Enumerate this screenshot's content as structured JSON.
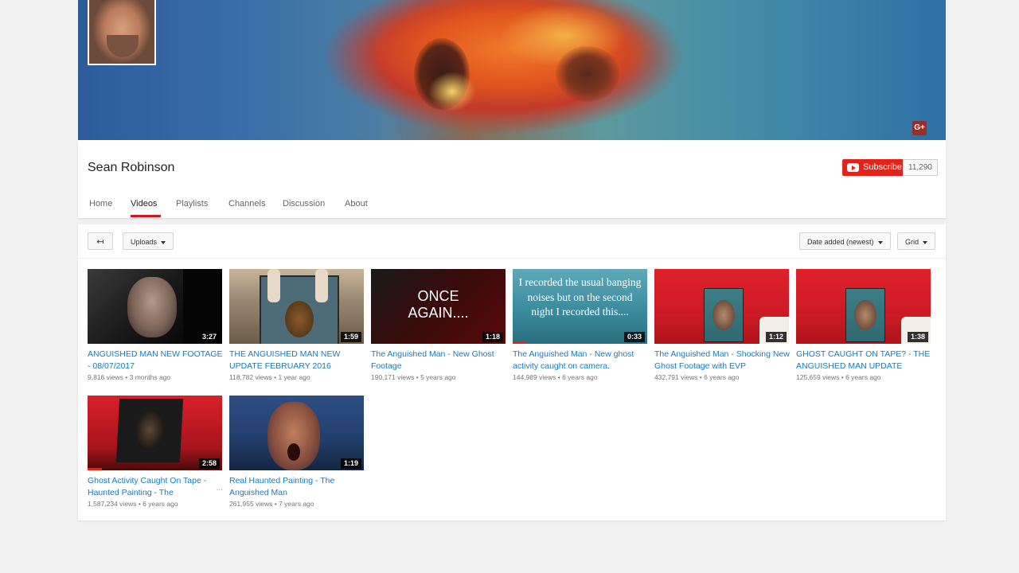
{
  "channel": {
    "name": "Sean Robinson",
    "subscribe_label": "Subscribe",
    "subscriber_count": "11,290",
    "gplus_label": "G+"
  },
  "tabs": [
    "Home",
    "Videos",
    "Playlists",
    "Channels",
    "Discussion",
    "About"
  ],
  "active_tab": "Videos",
  "toolbar": {
    "back_symbol": "↤",
    "uploads_label": "Uploads",
    "sort_label": "Date added (newest)",
    "view_label": "Grid"
  },
  "videos": [
    {
      "title": "ANGUISHED MAN NEW FOOTAGE - 08/07/2017",
      "views": "9,816 views",
      "age": "3 months ago",
      "duration": "3:27",
      "thumb_text": ""
    },
    {
      "title": "THE ANGUISHED MAN NEW UPDATE FEBRUARY 2016",
      "views": "118,782 views",
      "age": "1 year ago",
      "duration": "1:59",
      "thumb_text": ""
    },
    {
      "title": "The Anguished Man - New Ghost Footage",
      "views": "190,171 views",
      "age": "5 years ago",
      "duration": "1:18",
      "thumb_text": "ONCE AGAIN...."
    },
    {
      "title": "The Anguished Man - New ghost activity caught on camera.",
      "views": "144,989 views",
      "age": "6 years ago",
      "duration": "0:33",
      "thumb_text": "I recorded the usual banging noises but on the second night I recorded this...."
    },
    {
      "title": "The Anguished Man - Shocking New Ghost Footage with EVP",
      "views": "432,791 views",
      "age": "6 years ago",
      "duration": "1:12",
      "thumb_text": ""
    },
    {
      "title": "GHOST CAUGHT ON TAPE? - THE ANGUISHED MAN UPDATE",
      "views": "125,659 views",
      "age": "6 years ago",
      "duration": "1:38",
      "thumb_text": ""
    },
    {
      "title": "Ghost Activity Caught On Tape - Haunted Painting - The",
      "views": "1,587,234 views",
      "age": "6 years ago",
      "duration": "2:58",
      "thumb_text": ""
    },
    {
      "title": "Real Haunted Painting - The Anguished Man",
      "views": "261,955 views",
      "age": "7 years ago",
      "duration": "1:19",
      "thumb_text": ""
    }
  ],
  "separator": "•",
  "more_symbol": "...",
  "colors": {
    "accent": "#e62117",
    "link": "#167ac6",
    "meta": "#767676",
    "background": "#f1f1f1"
  }
}
